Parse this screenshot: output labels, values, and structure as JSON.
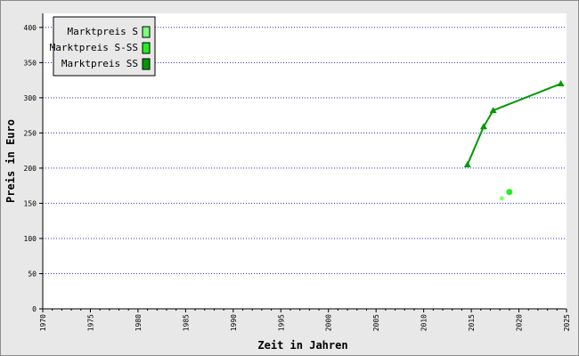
{
  "chart_data": {
    "type": "line",
    "xlabel": "Zeit in Jahren",
    "ylabel": "Preis in Euro",
    "xlim": [
      1970,
      2025
    ],
    "ylim": [
      0,
      420
    ],
    "x_ticks": [
      1970,
      1975,
      1980,
      1985,
      1990,
      1995,
      2000,
      2005,
      2010,
      2015,
      2020,
      2025
    ],
    "y_ticks": [
      0,
      50,
      100,
      150,
      200,
      250,
      300,
      350,
      400
    ],
    "grid": "horizontal dotted",
    "legend_position": "top-left",
    "series": [
      {
        "name": "Marktpreis S",
        "color": "#7cff7c",
        "marker": "circle",
        "line": false,
        "points": [
          [
            2018.2,
            157
          ]
        ]
      },
      {
        "name": "Marktpreis S-SS",
        "color": "#22ee22",
        "marker": "circle",
        "line": false,
        "points": [
          [
            2019,
            166
          ]
        ]
      },
      {
        "name": "Marktpreis SS",
        "color": "#009900",
        "marker": "triangle",
        "line": true,
        "points": [
          [
            2014.6,
            205
          ],
          [
            2016.3,
            259
          ],
          [
            2017.3,
            282
          ],
          [
            2024.4,
            320
          ]
        ]
      }
    ]
  }
}
